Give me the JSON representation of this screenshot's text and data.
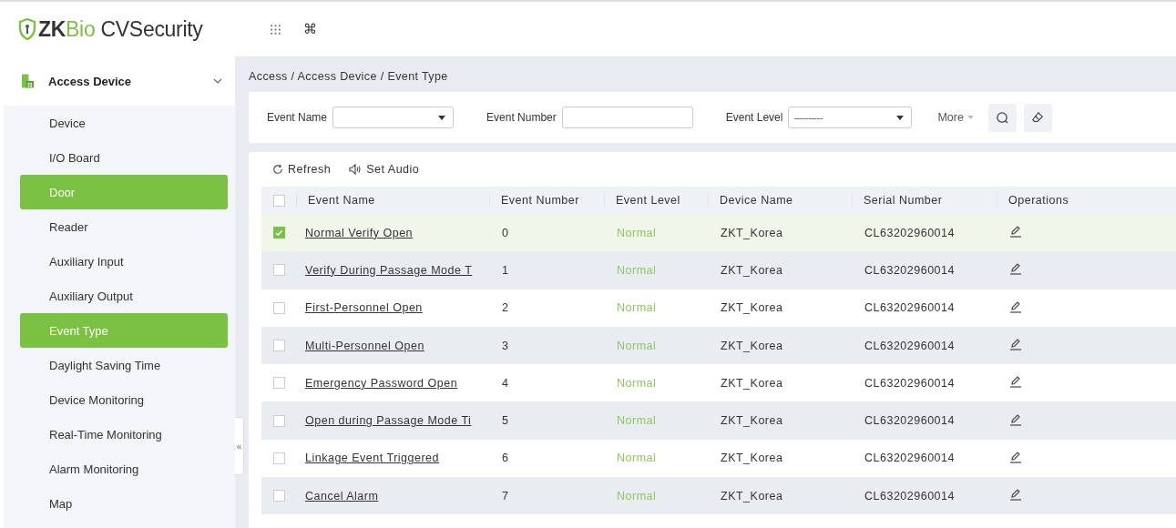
{
  "header": {
    "logo": {
      "brand": "ZK",
      "accent": "Bio",
      "product": " CVSecurity"
    },
    "shortcut_key": "⌘"
  },
  "sidebar": {
    "group": {
      "label": "Access Device",
      "expanded": true
    },
    "items": [
      {
        "label": "Device",
        "selected": false
      },
      {
        "label": "I/O Board",
        "selected": false
      },
      {
        "label": "Door",
        "selected": true
      },
      {
        "label": "Reader",
        "selected": false
      },
      {
        "label": "Auxiliary Input",
        "selected": false
      },
      {
        "label": "Auxiliary Output",
        "selected": false
      },
      {
        "label": "Event Type",
        "selected": true
      },
      {
        "label": "Daylight Saving Time",
        "selected": false
      },
      {
        "label": "Device Monitoring",
        "selected": false
      },
      {
        "label": "Real-Time Monitoring",
        "selected": false
      },
      {
        "label": "Alarm Monitoring",
        "selected": false
      },
      {
        "label": "Map",
        "selected": false
      }
    ],
    "collapse_handle": "«"
  },
  "breadcrumb": "Access / Access Device / Event Type",
  "filters": [
    {
      "kind": "select",
      "label": "Event Name"
    },
    {
      "kind": "text",
      "label": "Event Number"
    },
    {
      "kind": "select",
      "label": "Event Level",
      "value": "----------"
    }
  ],
  "more": "More",
  "toolbar": [
    {
      "kind": "refresh",
      "label": "Refresh"
    },
    {
      "kind": "audio",
      "label": "Set Audio"
    }
  ],
  "table": {
    "columns": [
      "Event Name",
      "Event Number",
      "Event Level",
      "Device Name",
      "Serial Number",
      "Operations"
    ],
    "all_checked": false,
    "rows": [
      {
        "checked": true,
        "event_name": "Normal Verify Open",
        "event_number": "0",
        "event_level": "Normal",
        "device_name": "ZKT_Korea",
        "serial_number": "CL63202960014"
      },
      {
        "checked": false,
        "event_name": "Verify During Passage Mode T",
        "event_number": "1",
        "event_level": "Normal",
        "device_name": "ZKT_Korea",
        "serial_number": "CL63202960014"
      },
      {
        "checked": false,
        "event_name": "First-Personnel Open",
        "event_number": "2",
        "event_level": "Normal",
        "device_name": "ZKT_Korea",
        "serial_number": "CL63202960014"
      },
      {
        "checked": false,
        "event_name": "Multi-Personnel Open",
        "event_number": "3",
        "event_level": "Normal",
        "device_name": "ZKT_Korea",
        "serial_number": "CL63202960014"
      },
      {
        "checked": false,
        "event_name": "Emergency Password Open",
        "event_number": "4",
        "event_level": "Normal",
        "device_name": "ZKT_Korea",
        "serial_number": "CL63202960014"
      },
      {
        "checked": false,
        "event_name": "Open during Passage Mode Ti",
        "event_number": "5",
        "event_level": "Normal",
        "device_name": "ZKT_Korea",
        "serial_number": "CL63202960014"
      },
      {
        "checked": false,
        "event_name": "Linkage Event Triggered",
        "event_number": "6",
        "event_level": "Normal",
        "device_name": "ZKT_Korea",
        "serial_number": "CL63202960014"
      },
      {
        "checked": false,
        "event_name": "Cancel Alarm",
        "event_number": "7",
        "event_level": "Normal",
        "device_name": "ZKT_Korea",
        "serial_number": "CL63202960014"
      }
    ]
  }
}
